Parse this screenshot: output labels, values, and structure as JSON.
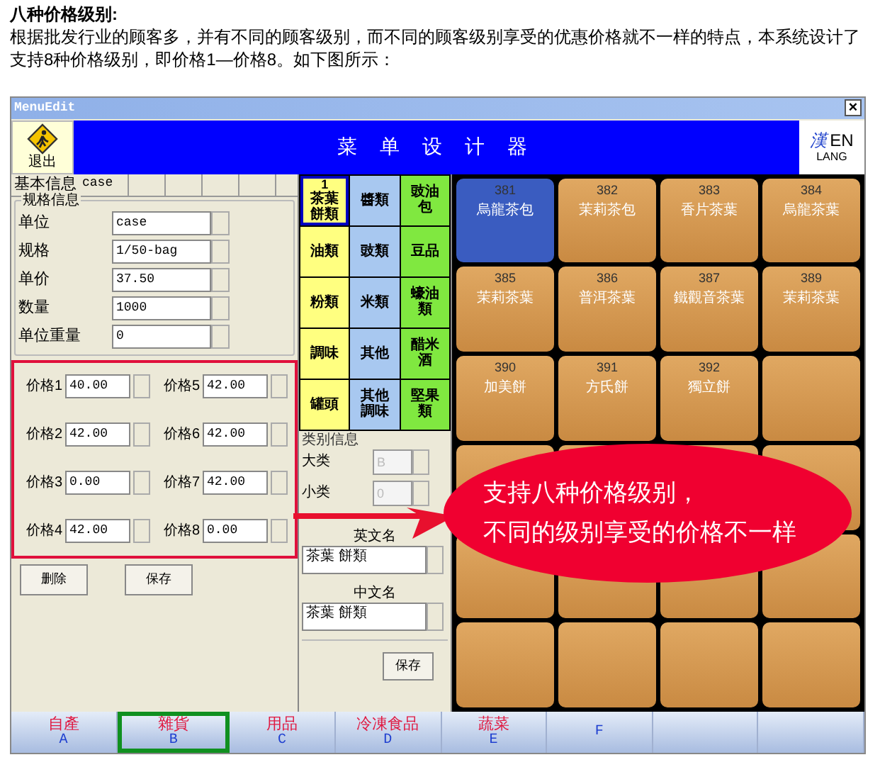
{
  "intro": {
    "heading": "八种价格级别:",
    "text": "根据批发行业的顾客多，并有不同的顾客级别，而不同的顾客级别享受的优惠价格就不一样的特点，本系统设计了支持8种价格级别，即价格1—价格8。如下图所示："
  },
  "window": {
    "title": "MenuEdit",
    "close": "×"
  },
  "header": {
    "exit_label": "退出",
    "title": "菜 单 设 计 器",
    "lang_glyph": "漢",
    "lang_code": "EN",
    "lang_label": "LANG"
  },
  "left_panel": {
    "tabs": [
      {
        "label": "基本信息",
        "value": "case",
        "selected": true
      }
    ],
    "spec_group": {
      "legend": "规格信息",
      "fields": [
        {
          "label": "单位",
          "value": "case"
        },
        {
          "label": "规格",
          "value": "1/50-bag"
        },
        {
          "label": "单价",
          "value": "37.50"
        },
        {
          "label": "数量",
          "value": "1000"
        },
        {
          "label": "单位重量",
          "value": "0"
        }
      ]
    },
    "prices": [
      {
        "label": "价格1",
        "value": "40.00"
      },
      {
        "label": "价格5",
        "value": "42.00"
      },
      {
        "label": "价格2",
        "value": "42.00"
      },
      {
        "label": "价格6",
        "value": "42.00"
      },
      {
        "label": "价格3",
        "value": "0.00"
      },
      {
        "label": "价格7",
        "value": "42.00"
      },
      {
        "label": "价格4",
        "value": "42.00"
      },
      {
        "label": "价格8",
        "value": "0.00"
      }
    ],
    "buttons": [
      "删除",
      "保存"
    ]
  },
  "categories": [
    {
      "number": "1",
      "label": "茶葉餅類",
      "color": "#ffff80",
      "selected": true
    },
    {
      "label": "醬類",
      "color": "#a8c8f0",
      "selected": false
    },
    {
      "label": "豉油包",
      "color": "#80e840",
      "selected": false
    },
    {
      "label": "油類",
      "color": "#ffff80",
      "selected": false
    },
    {
      "label": "豉類",
      "color": "#a8c8f0",
      "selected": false
    },
    {
      "label": "豆品",
      "color": "#80e840",
      "selected": false
    },
    {
      "label": "粉類",
      "color": "#ffff80",
      "selected": false
    },
    {
      "label": "米類",
      "color": "#a8c8f0",
      "selected": false
    },
    {
      "label": "蠔油類",
      "color": "#80e840",
      "selected": false
    },
    {
      "label": "調味",
      "color": "#ffff80",
      "selected": false
    },
    {
      "label": "其他",
      "color": "#a8c8f0",
      "selected": false
    },
    {
      "label": "醋米酒",
      "color": "#80e840",
      "selected": false
    },
    {
      "label": "罐頭",
      "color": "#ffff80",
      "selected": false
    },
    {
      "label": "其他調味",
      "color": "#a8c8f0",
      "selected": false
    },
    {
      "label": "堅果類",
      "color": "#80e840",
      "selected": false
    }
  ],
  "category_info": {
    "legend": "类别信息",
    "fields": [
      {
        "label": "大类",
        "value": "B",
        "disabled": true
      },
      {
        "label": "小类",
        "value": "0",
        "disabled": true
      }
    ],
    "english_name": {
      "label": "英文名",
      "value": "茶葉 餅類"
    },
    "chinese_name": {
      "label": "中文名",
      "value": "茶葉 餅類"
    },
    "save": "保存"
  },
  "products": [
    {
      "code": "381",
      "name": "烏龍茶包",
      "selected": true
    },
    {
      "code": "382",
      "name": "茉莉茶包",
      "selected": false
    },
    {
      "code": "383",
      "name": "香片茶葉",
      "selected": false
    },
    {
      "code": "384",
      "name": "烏龍茶葉",
      "selected": false
    },
    {
      "code": "385",
      "name": "茉莉茶葉",
      "selected": false
    },
    {
      "code": "386",
      "name": "普洱茶葉",
      "selected": false
    },
    {
      "code": "387",
      "name": "鐵觀音茶葉",
      "selected": false
    },
    {
      "code": "389",
      "name": "茉莉茶葉",
      "selected": false
    },
    {
      "code": "390",
      "name": "加美餅",
      "selected": false
    },
    {
      "code": "391",
      "name": "方氏餅",
      "selected": false
    },
    {
      "code": "392",
      "name": "獨立餅",
      "selected": false
    }
  ],
  "bottom_tabs": [
    {
      "label": "自產",
      "letter": "A",
      "selected": false
    },
    {
      "label": "雜貨",
      "letter": "B",
      "selected": true
    },
    {
      "label": "用品",
      "letter": "C",
      "selected": false
    },
    {
      "label": "冷凍食品",
      "letter": "D",
      "selected": false
    },
    {
      "label": "蔬菜",
      "letter": "E",
      "selected": false
    },
    {
      "letter": "F",
      "selected": false
    }
  ],
  "callout": {
    "lines": [
      "支持八种价格级别，",
      "不同的级别享受的价格不一样"
    ]
  }
}
